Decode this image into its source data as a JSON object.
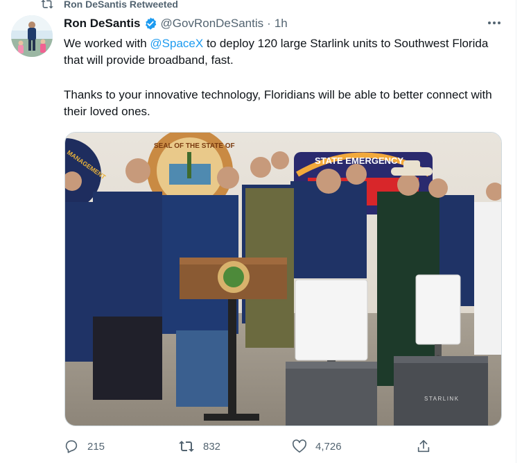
{
  "retweet": {
    "label": "Ron DeSantis Retweeted",
    "icon": "retweet-icon"
  },
  "author": {
    "name": "Ron DeSantis",
    "verified": true,
    "handle": "@GovRonDeSantis",
    "separator": "·",
    "time": "1h"
  },
  "tweet": {
    "line1_before": "We worked with ",
    "mention": "@SpaceX",
    "line1_after": " to deploy 120 large Starlink units to Southwest Florida that will provide broadband, fast.",
    "paragraph2": "Thanks to your innovative technology, Floridians will be able to better connect with their loved ones."
  },
  "media": {
    "box_label": "STARLINK",
    "banner_text": "STATE EMERGENCY",
    "seal_text": "SEAL OF THE STATE OF",
    "left_banner_text": "MANAGEMENT"
  },
  "actions": {
    "replies": "215",
    "retweets": "832",
    "likes": "4,726"
  },
  "colors": {
    "accent": "#1d9bf0",
    "secondary_text": "#536471",
    "primary_text": "#0f1419"
  }
}
